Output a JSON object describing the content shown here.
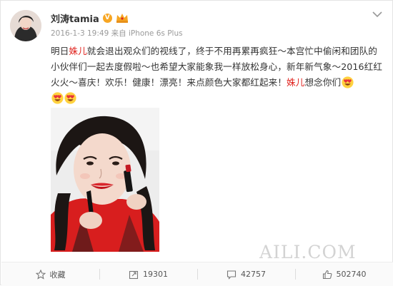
{
  "author": {
    "name": "刘涛tamia",
    "verified_icon": "v-badge-icon",
    "member_icon": "crown-icon"
  },
  "meta": {
    "date": "2016-1-3 19:49",
    "source": "来自 iPhone 6s Plus"
  },
  "post": {
    "seg1": "明日",
    "hl1": "姝儿",
    "seg2": "就会退出观众们的视线了，终于不用再累再疯狂～本宫忙中偷闲和团队的小伙伴们一起去度假啦～也希望大家能象我一样放松身心，新年新气象～2016红红火火～喜庆！欢乐！健康！漂亮！来点颜色大家都红起来！",
    "hl2": "姝儿",
    "seg3": "想念你们",
    "emoji": "heart-eyes-emoji-icon"
  },
  "watermark": "AILI.COM",
  "actions": [
    {
      "icon": "star-icon",
      "label": "收藏"
    },
    {
      "icon": "share-icon",
      "label": "19301"
    },
    {
      "icon": "comment-icon",
      "label": "42757"
    },
    {
      "icon": "thumbs-up-icon",
      "label": "502740"
    }
  ],
  "colors": {
    "highlight": "#e0231e",
    "badge": "#f7a623",
    "meta": "#9a9a9a"
  }
}
